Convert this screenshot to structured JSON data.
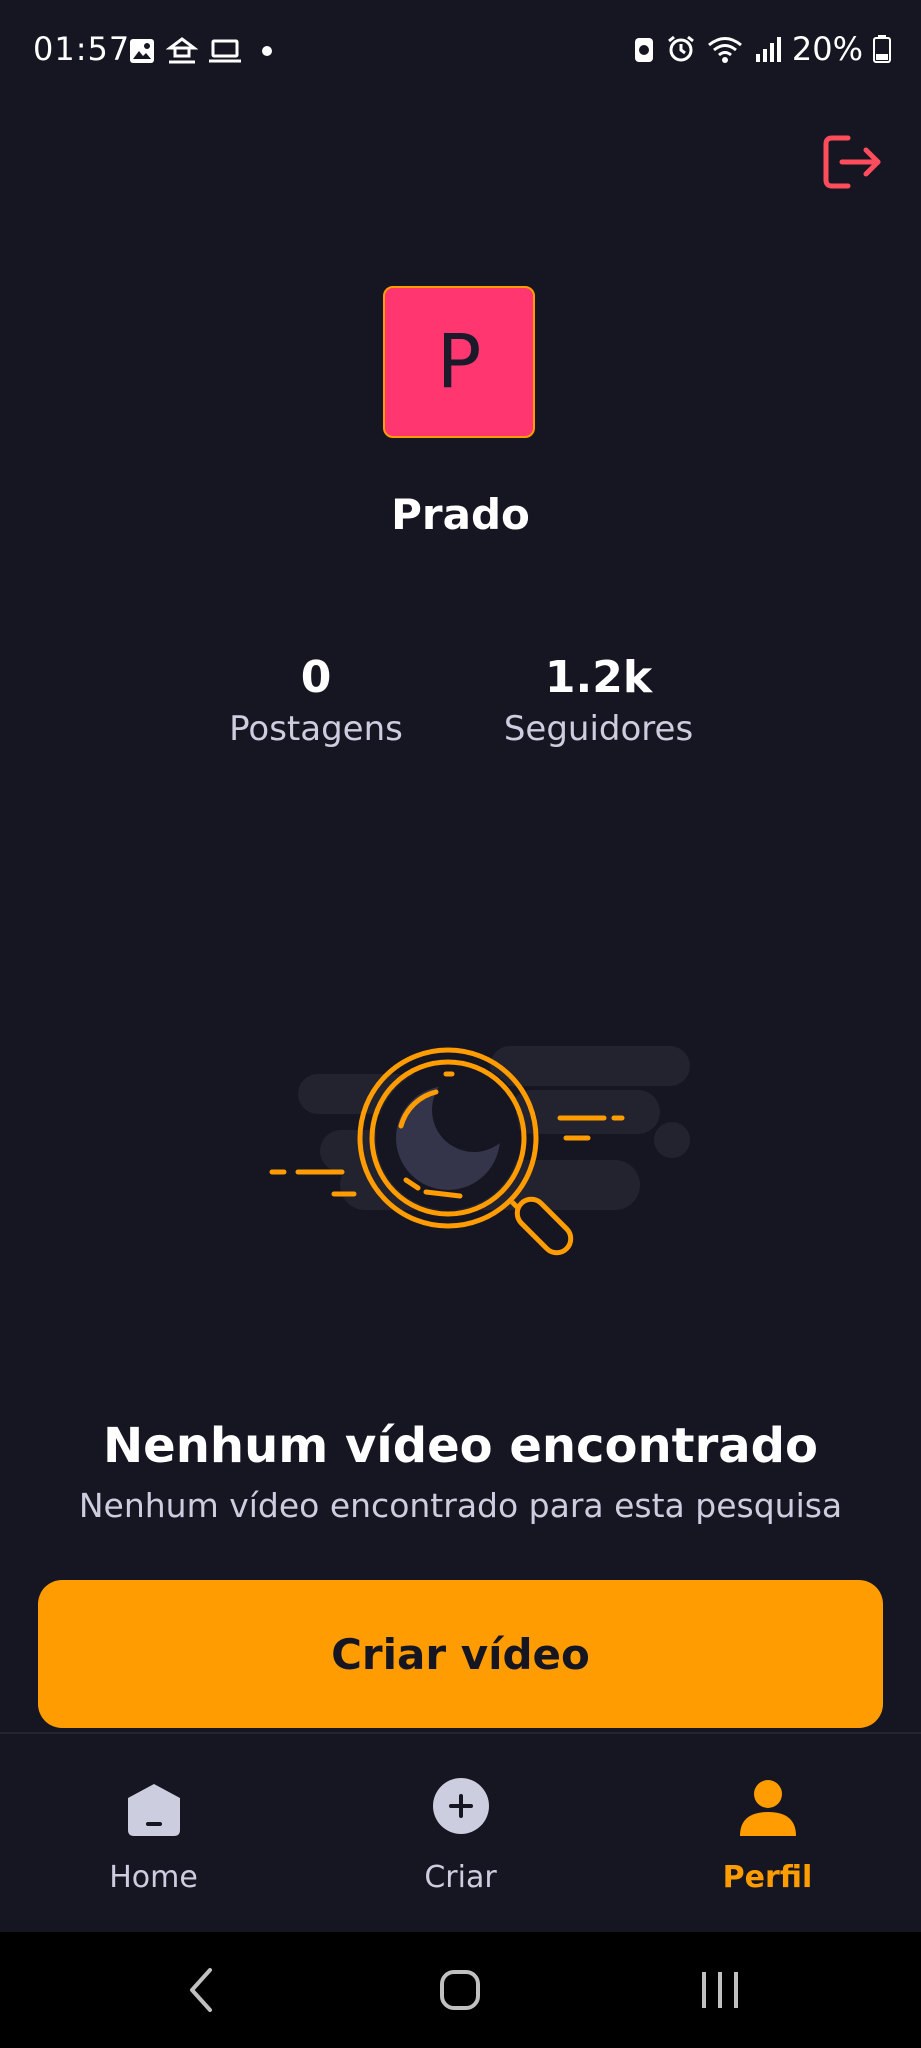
{
  "status_bar": {
    "time": "01:57",
    "battery": "20%"
  },
  "profile": {
    "avatar_initial": "P",
    "username": "Prado",
    "stats": [
      {
        "value": "0",
        "label": "Postagens"
      },
      {
        "value": "1.2k",
        "label": "Seguidores"
      }
    ]
  },
  "empty_state": {
    "title": "Nenhum vídeo encontrado",
    "subtitle": "Nenhum vídeo encontrado para esta pesquisa",
    "button_label": "Criar vídeo"
  },
  "tabs": [
    {
      "label": "Home",
      "icon": "home-icon",
      "active": false
    },
    {
      "label": "Criar",
      "icon": "plus-icon",
      "active": false
    },
    {
      "label": "Perfil",
      "icon": "profile-icon",
      "active": true
    }
  ],
  "colors": {
    "background": "#161622",
    "accent": "#ff9c01",
    "avatar": "#ff3670",
    "logout": "#ff4d5e"
  }
}
